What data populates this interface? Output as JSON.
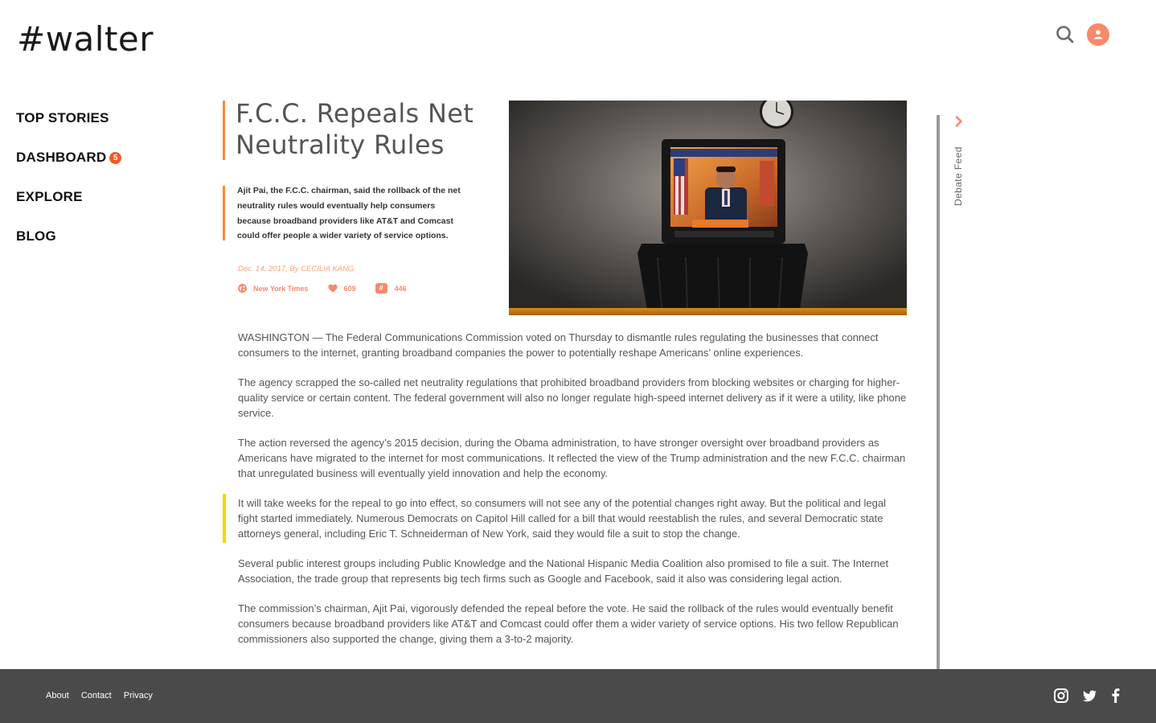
{
  "app": {
    "logo": "#walter"
  },
  "header": {
    "search_icon": "search-icon",
    "user_icon": "user-icon",
    "accent": "#f58a6c"
  },
  "nav": {
    "items": [
      {
        "label": "TOP STORIES"
      },
      {
        "label": "DASHBOARD",
        "badge": "5"
      },
      {
        "label": "EXPLORE"
      },
      {
        "label": "BLOG"
      }
    ]
  },
  "article": {
    "title": "F.C.C. Repeals Net Neutrality Rules",
    "summary": "Ajit Pai, the F.C.C. chairman, said the rollback of the net neutrality rules would eventually help consumers because broadband providers like AT&T and Comcast could offer people a wider variety of service options.",
    "date_byline": "Dec. 14, 2017, By CECILIA KANG",
    "source": "New York Times",
    "likes": "609",
    "hashtags": "446",
    "hashtag_symbol": "#",
    "paragraphs": [
      "WASHINGTON — The Federal Communications Commission voted on Thursday to dismantle rules regulating the businesses that connect consumers to the internet, granting broadband companies the power to potentially reshape Americans’ online experiences.",
      "The agency scrapped the so-called net neutrality regulations that prohibited broadband providers from blocking websites or charging for higher-quality service or certain content. The federal government will also no longer regulate high-speed internet delivery as if it were a utility, like phone service.",
      "The action reversed the agency’s 2015 decision, during the Obama administration, to have stronger oversight over broadband providers as Americans have migrated to the internet for most communications. It reflected the view of the Trump administration and the new F.C.C. chairman that unregulated business will eventually yield innovation and help the economy.",
      "It will take weeks for the repeal to go into effect, so consumers will not see any of the potential changes right away. But the political and legal fight started immediately. Numerous Democrats on Capitol Hill called for a bill that would reestablish the rules, and several Democratic state attorneys general, including Eric T. Schneiderman of New York, said they would file a suit to stop the change.",
      "Several public interest groups including Public Knowledge and the National Hispanic Media Coalition also promised to file a suit. The Internet Association, the trade group that represents big tech firms such as Google and Facebook, said it also was considering legal action.",
      "The commission’s chairman, Ajit Pai, vigorously defended the repeal before the vote. He said the rollback of the rules would eventually benefit consumers because broadband providers like AT&T and Comcast could offer them a wider variety of service options. His two fellow Republican commissioners also supported the change, giving them a 3-to-2 majority."
    ]
  },
  "feed": {
    "label": "Debate Feed"
  },
  "footer": {
    "links": [
      "About",
      "Contact",
      "Privacy"
    ],
    "social": [
      "instagram-icon",
      "twitter-icon",
      "facebook-icon"
    ]
  }
}
